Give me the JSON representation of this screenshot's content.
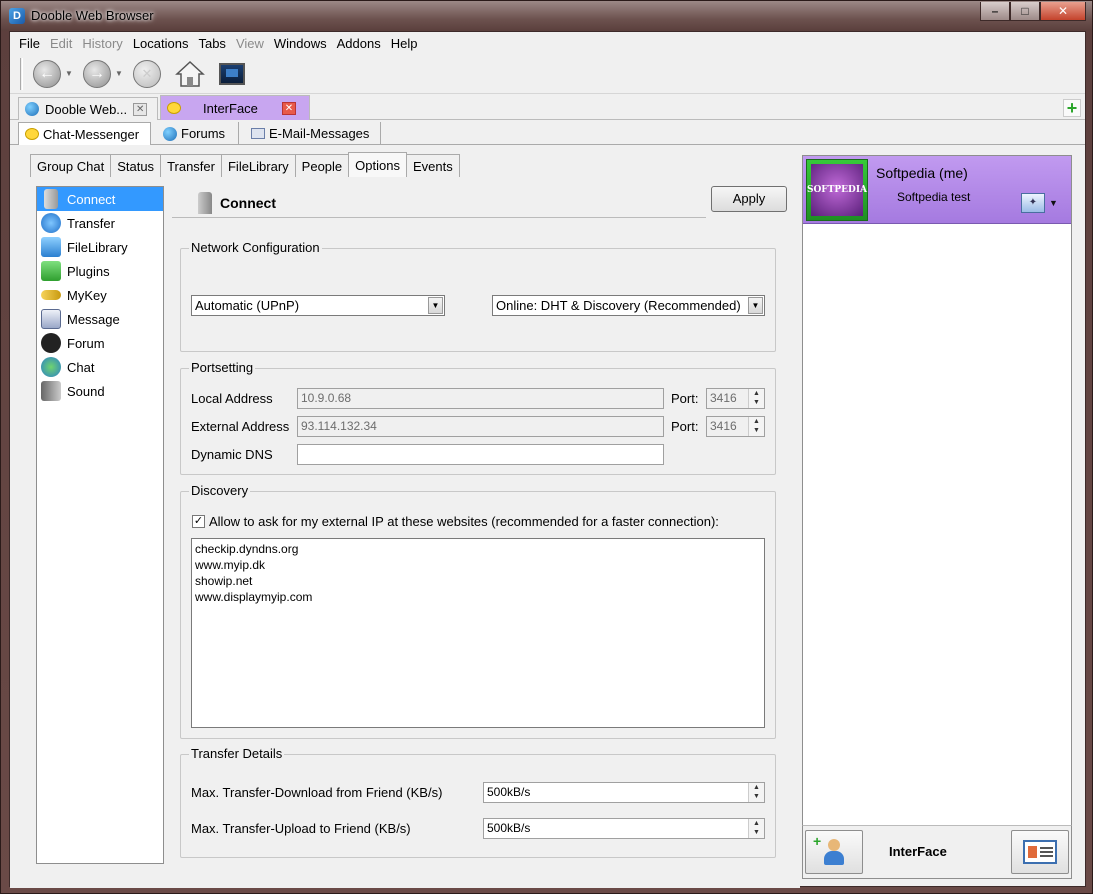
{
  "window": {
    "title": "Dooble Web Browser",
    "buttons": {
      "minimize": "–",
      "maximize": "□",
      "close": "✕"
    }
  },
  "menu": [
    "File",
    "Edit",
    "History",
    "Locations",
    "Tabs",
    "View",
    "Windows",
    "Addons",
    "Help"
  ],
  "menu_disabled": [
    "Edit",
    "History",
    "View"
  ],
  "browser_tabs": [
    {
      "label": "Dooble Web...",
      "active": false
    },
    {
      "label": "InterFace",
      "active": true
    }
  ],
  "interface_tabs": [
    "Chat-Messenger",
    "Forums",
    "E-Mail-Messages"
  ],
  "options_tabs": [
    "Group Chat",
    "Status",
    "Transfer",
    "FileLibrary",
    "People",
    "Options",
    "Events"
  ],
  "active_options_tab": "Options",
  "sidebar": [
    {
      "label": "Connect",
      "icon": "connect-icon",
      "selected": true
    },
    {
      "label": "Transfer",
      "icon": "transfer-icon",
      "selected": false
    },
    {
      "label": "FileLibrary",
      "icon": "filelibrary-icon",
      "selected": false
    },
    {
      "label": "Plugins",
      "icon": "plugins-icon",
      "selected": false
    },
    {
      "label": "MyKey",
      "icon": "mykey-icon",
      "selected": false
    },
    {
      "label": "Message",
      "icon": "message-icon",
      "selected": false
    },
    {
      "label": "Forum",
      "icon": "forum-icon",
      "selected": false
    },
    {
      "label": "Chat",
      "icon": "chat-icon",
      "selected": false
    },
    {
      "label": "Sound",
      "icon": "sound-icon",
      "selected": false
    }
  ],
  "connect": {
    "title": "Connect",
    "apply": "Apply",
    "network": {
      "legend": "Network Configuration",
      "mode": "Automatic (UPnP)",
      "discovery_mode": "Online: DHT & Discovery (Recommended)"
    },
    "ports": {
      "legend": "Portsetting",
      "local_label": "Local Address",
      "local_value": "10.9.0.68",
      "external_label": "External Address",
      "external_value": "93.114.132.34",
      "port_label": "Port:",
      "local_port": "3416",
      "external_port": "3416",
      "ddns_label": "Dynamic DNS",
      "ddns_value": ""
    },
    "discovery": {
      "legend": "Discovery",
      "check_label": "Allow to ask for my external IP at these websites (recommended for a faster connection):",
      "checked": true,
      "sites": [
        "checkip.dyndns.org",
        "www.myip.dk",
        "showip.net",
        "www.displaymyip.com"
      ]
    },
    "transfer": {
      "legend": "Transfer Details",
      "download_label": "Max. Transfer-Download from Friend (KB/s)",
      "download_value": "500kB/s",
      "upload_label": "Max. Transfer-Upload to Friend (KB/s)",
      "upload_value": "500kB/s"
    }
  },
  "profile": {
    "name": "Softpedia (me)",
    "status": "Softpedia test",
    "avatar_text": "SOFTPEDIA"
  },
  "bottom": {
    "label": "InterFace"
  },
  "colors": {
    "selection": "#3399ff",
    "profile_bg": "#b58ae8",
    "active_tab": "#c8a6f0"
  }
}
